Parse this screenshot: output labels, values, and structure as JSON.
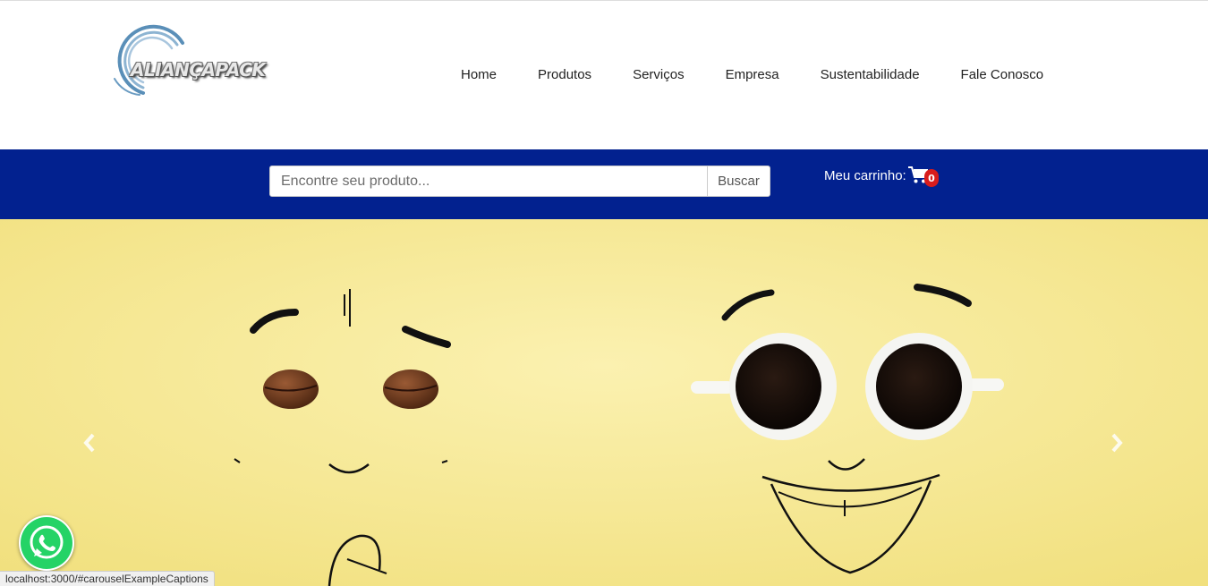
{
  "brand": {
    "name": "ALIANÇAPACK"
  },
  "nav": {
    "items": [
      {
        "label": "Home"
      },
      {
        "label": "Produtos"
      },
      {
        "label": "Serviços"
      },
      {
        "label": "Empresa"
      },
      {
        "label": "Sustentabilidade"
      },
      {
        "label": "Fale Conosco"
      }
    ]
  },
  "search": {
    "placeholder": "Encontre seu produto...",
    "value": "",
    "button_label": "Buscar"
  },
  "cart": {
    "label": "Meu carrinho:",
    "count": "0",
    "icon": "shopping-cart-icon"
  },
  "carousel": {
    "prev_icon": "chevron-left-icon",
    "next_icon": "chevron-right-icon"
  },
  "whatsapp": {
    "icon": "whatsapp-icon"
  },
  "status_bar": {
    "url": "localhost:3000/#carouselExampleCaptions"
  },
  "colors": {
    "search_bar_bg": "#02218f",
    "carousel_bg": "#f6e89a",
    "badge": "#d81c1c",
    "whatsapp": "#25d366"
  }
}
